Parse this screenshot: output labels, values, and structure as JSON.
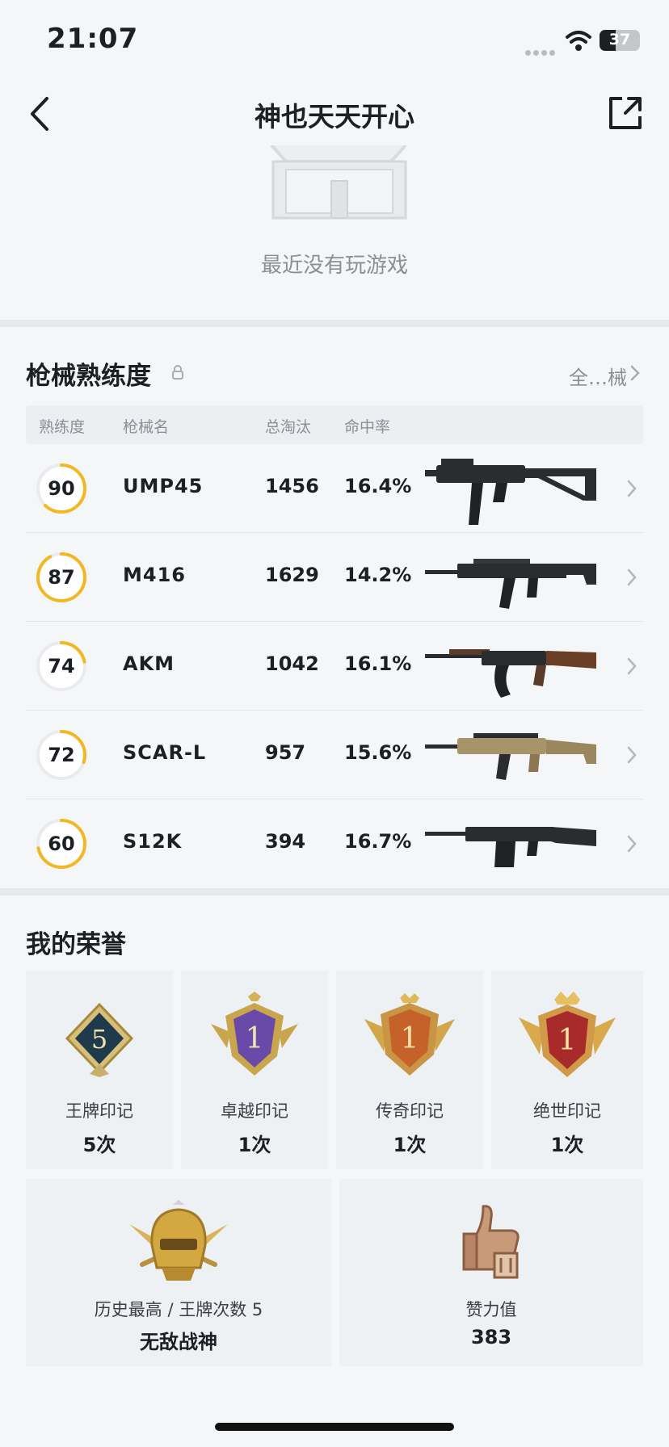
{
  "status_bar": {
    "time": "21:07",
    "battery": "37"
  },
  "nav": {
    "title": "神也天天开心"
  },
  "recent": {
    "empty_text": "最近没有玩游戏"
  },
  "weapons": {
    "title": "枪械熟练度",
    "all_link": "全…械",
    "headers": {
      "proficiency": "熟练度",
      "name": "枪械名",
      "kills": "总淘汰",
      "accuracy": "命中率"
    },
    "rows": [
      {
        "proficiency": "90",
        "progress": 0.62,
        "name": "UMP45",
        "kills": "1456",
        "accuracy": "16.4%"
      },
      {
        "proficiency": "87",
        "progress": 0.92,
        "name": "M416",
        "kills": "1629",
        "accuracy": "14.2%"
      },
      {
        "proficiency": "74",
        "progress": 0.22,
        "name": "AKM",
        "kills": "1042",
        "accuracy": "16.1%"
      },
      {
        "proficiency": "72",
        "progress": 0.3,
        "name": "SCAR-L",
        "kills": "957",
        "accuracy": "15.6%"
      },
      {
        "proficiency": "60",
        "progress": 0.72,
        "name": "S12K",
        "kills": "394",
        "accuracy": "16.7%"
      }
    ]
  },
  "honors": {
    "title": "我的荣誉",
    "badges": [
      {
        "label": "王牌印记",
        "count": "5次",
        "badge_number": "5"
      },
      {
        "label": "卓越印记",
        "count": "1次",
        "badge_number": "1"
      },
      {
        "label": "传奇印记",
        "count": "1次",
        "badge_number": "1"
      },
      {
        "label": "绝世印记",
        "count": "1次",
        "badge_number": "1"
      }
    ],
    "highest": {
      "label": "历史最高 / 王牌次数 5",
      "value": "无敌战神"
    },
    "likes": {
      "label": "赞力值",
      "value": "383"
    }
  },
  "colors": {
    "accent": "#f2b824",
    "ring_track": "#e9ebee",
    "background": "#f4f6f8"
  }
}
